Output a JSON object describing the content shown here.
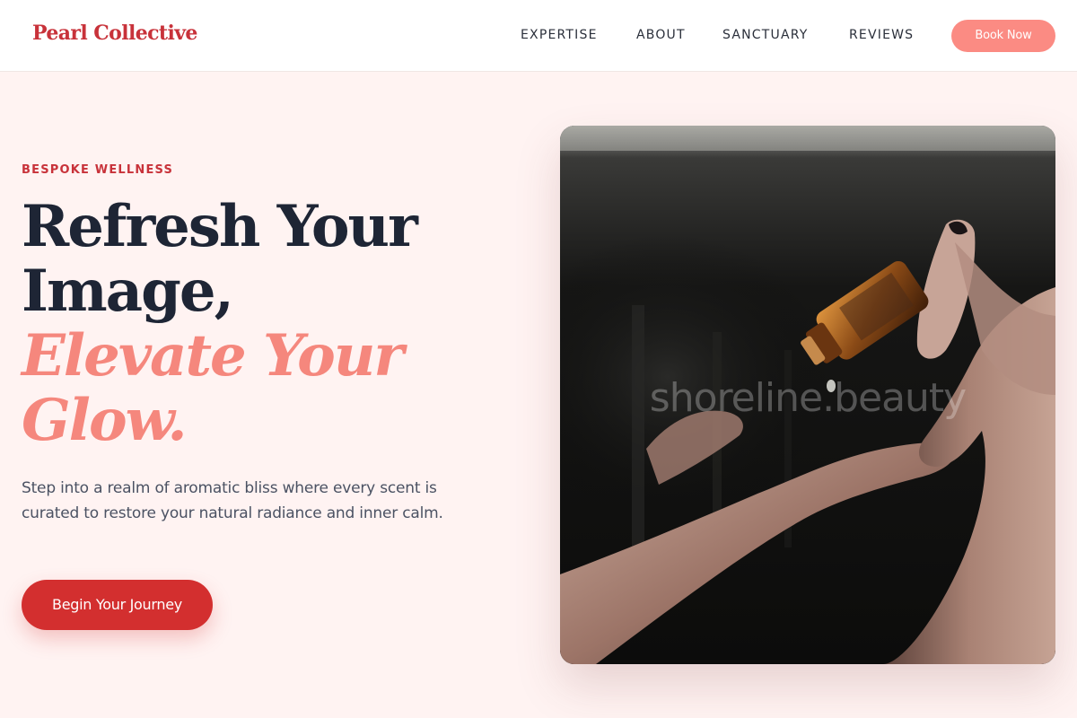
{
  "brand": {
    "name": "Pearl Collective"
  },
  "nav": {
    "items": [
      {
        "label": "EXPERTISE"
      },
      {
        "label": "ABOUT"
      },
      {
        "label": "SANCTUARY"
      },
      {
        "label": "REVIEWS"
      }
    ],
    "cta_label": "Book Now"
  },
  "hero": {
    "eyebrow": "BESPOKE WELLNESS",
    "headline_line1": "Refresh Your",
    "headline_line2": "Image,",
    "headline_accent_line1": "Elevate Your",
    "headline_accent_line2": "Glow.",
    "description": "Step into a realm of aromatic bliss where every scent is curated to restore your natural radiance and inner calm.",
    "cta_label": "Begin Your Journey",
    "image": {
      "watermark": "shoreline.beauty",
      "subject": "hands holding amber essential oil bottle with dropper"
    }
  },
  "colors": {
    "brand": "#c8323a",
    "accent": "#f5877d",
    "button_primary": "#d32f2f",
    "button_nav": "#fb8b83",
    "background": "#fff3f2",
    "heading": "#1e2535"
  }
}
